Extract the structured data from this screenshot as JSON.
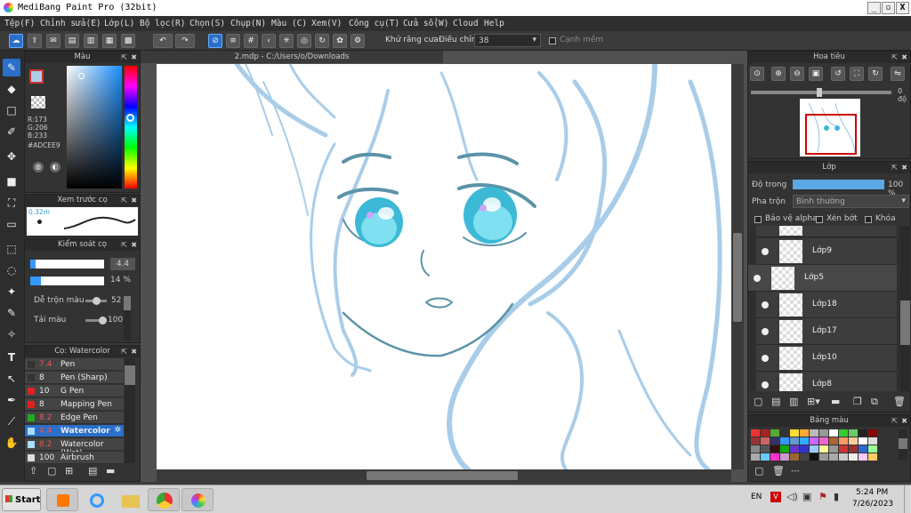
{
  "app": {
    "title": "MediBang Paint Pro (32bit)"
  },
  "window_controls": {
    "minimize": "_",
    "maximize": "▫",
    "close": "X"
  },
  "menu": [
    "Tệp(F)",
    "Chỉnh sửa(E)",
    "Lớp(L)",
    "Bộ lọc(R)",
    "Chọn(S)",
    "Chụp(N)",
    "Màu (C)",
    "Xem(V)",
    "Công cụ(T)",
    "Cửa sổ(W)",
    "Cloud",
    "Help"
  ],
  "toolbar": {
    "antialias_label": "Khử răng cưa",
    "correction_label": "Điều chỉnh",
    "correction_value": "38",
    "edge_label": "Cạnh mềm"
  },
  "color_panel": {
    "title": "Màu",
    "r": "R:173",
    "g": "G:206",
    "b": "B:233",
    "hex": "#ADCEE9",
    "accent": "#adcee9"
  },
  "brush_preview_panel": {
    "title": "Xem trước cọ",
    "size": "0.32m"
  },
  "brush_control_panel": {
    "title": "Kiểm soát cọ",
    "size_value": "4.4",
    "opacity_value": "14 %",
    "blend_label": "Dễ trộn màu",
    "blend_value": "52",
    "load_label": "Tải màu",
    "load_value": "100"
  },
  "brush_list_panel": {
    "title": "Cọ: Watercolor",
    "items": [
      {
        "size": "7.4",
        "name": "Pen",
        "color": "#333333"
      },
      {
        "size": "8",
        "name": "Pen (Sharp)",
        "color": "#333333"
      },
      {
        "size": "10",
        "name": "G Pen",
        "color": "#dd2222"
      },
      {
        "size": "8",
        "name": "Mapping Pen",
        "color": "#dd2222"
      },
      {
        "size": "8.2",
        "name": "Edge Pen",
        "color": "#22aa22"
      },
      {
        "size": "4.4",
        "name": "Watercolor",
        "color": "#aaddff"
      },
      {
        "size": "8.2",
        "name": "Watercolor (Wet)",
        "color": "#aaddff"
      },
      {
        "size": "100",
        "name": "Airbrush",
        "color": "#dddddd"
      }
    ]
  },
  "document": {
    "tab": "2.mdp - C:/Users/o/Downloads"
  },
  "navigator": {
    "title": "Hoa tiêu",
    "zoom": "0 độ"
  },
  "layers_panel": {
    "title": "Lớp",
    "opacity_label": "Độ trong",
    "opacity_value": "100 %",
    "blend_label": "Pha trộn",
    "blend_value": "Bình thường",
    "protect_alpha": "Bảo vệ alpha",
    "clipping": "Xén bớt",
    "lock": "Khóa",
    "layers": [
      {
        "name": "Lớp9"
      },
      {
        "name": "Lớp5"
      },
      {
        "name": "Lớp18"
      },
      {
        "name": "Lớp17"
      },
      {
        "name": "Lớp10"
      },
      {
        "name": "Lớp8"
      }
    ]
  },
  "palette_panel": {
    "title": "Bảng màu",
    "footer_text": "---",
    "colors": [
      "#e33",
      "#a22",
      "#5a3",
      "#333",
      "#fd3",
      "#fa3",
      "#bbb",
      "#999",
      "#fff",
      "#3c3",
      "#6c6",
      "#222",
      "#800",
      "#933",
      "#c66",
      "#336",
      "#39f",
      "#69c",
      "#3af",
      "#c6f",
      "#e6c",
      "#a63",
      "#f96",
      "#fc9",
      "#fff",
      "#ddd",
      "#888",
      "#555",
      "#311",
      "#1a1",
      "#63c",
      "#33c",
      "#9cf",
      "#ff9",
      "#999",
      "#c33",
      "#933",
      "#36c",
      "#9f9",
      "#aaa",
      "#6cf",
      "#f3c",
      "#c9c",
      "#963",
      "#444",
      "#111",
      "#999",
      "#aaa",
      "#ccc",
      "#eee",
      "#fcf",
      "#fc6"
    ]
  },
  "taskbar": {
    "start": "Start",
    "lang": "EN",
    "time": "5:24 PM",
    "date": "7/26/2023"
  }
}
